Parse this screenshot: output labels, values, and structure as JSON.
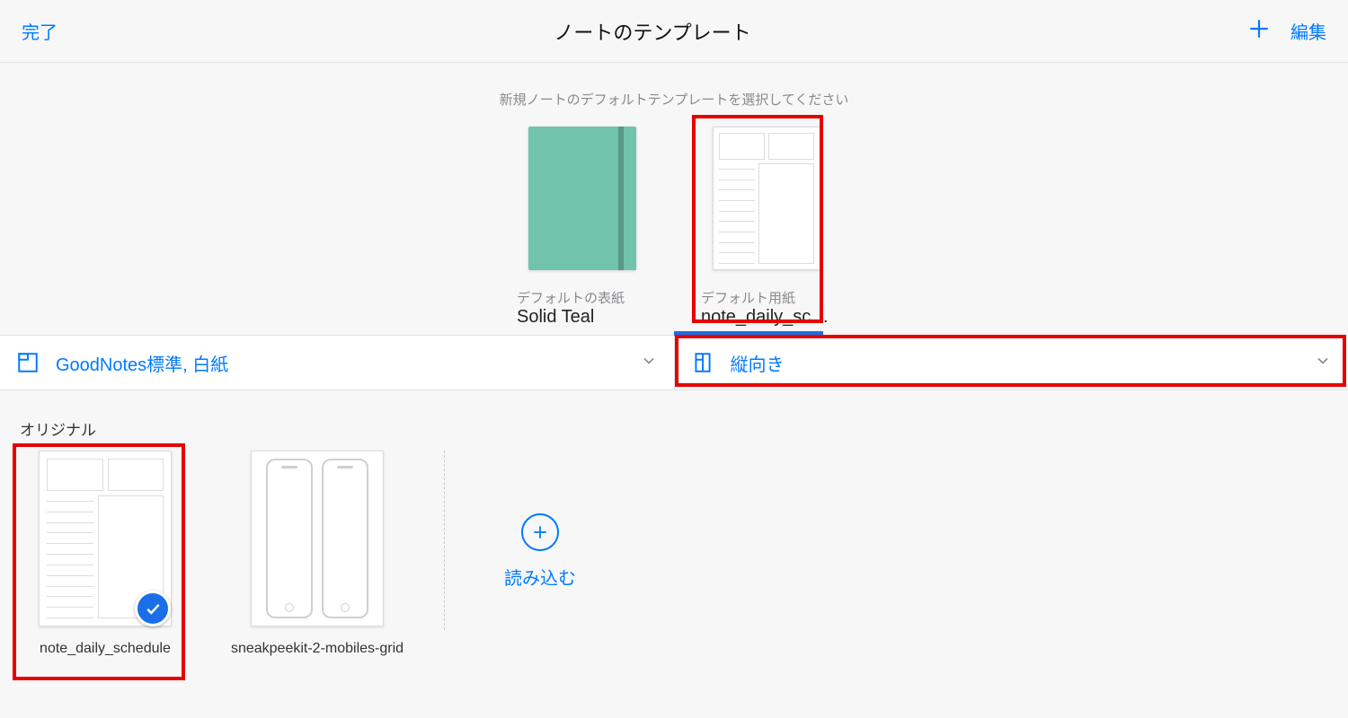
{
  "header": {
    "done": "完了",
    "title": "ノートのテンプレート",
    "edit": "編集"
  },
  "instruction": "新規ノートのデフォルトテンプレートを選択してください",
  "defaults": {
    "cover": {
      "label": "デフォルトの表紙",
      "name": "Solid Teal"
    },
    "paper": {
      "label": "デフォルト用紙",
      "name": "note_daily_sche…"
    }
  },
  "filters": {
    "left": "GoodNotes標準, 白紙",
    "right": "縦向き"
  },
  "section": "オリジナル",
  "templates": [
    {
      "name": "note_daily_schedule",
      "selected": true
    },
    {
      "name": "sneakpeekit-2-mobiles-grid",
      "selected": false
    }
  ],
  "import_label": "読み込む",
  "colors": {
    "accent": "#007aff",
    "teal": "#71c3ac",
    "highlight": "#e70000"
  }
}
